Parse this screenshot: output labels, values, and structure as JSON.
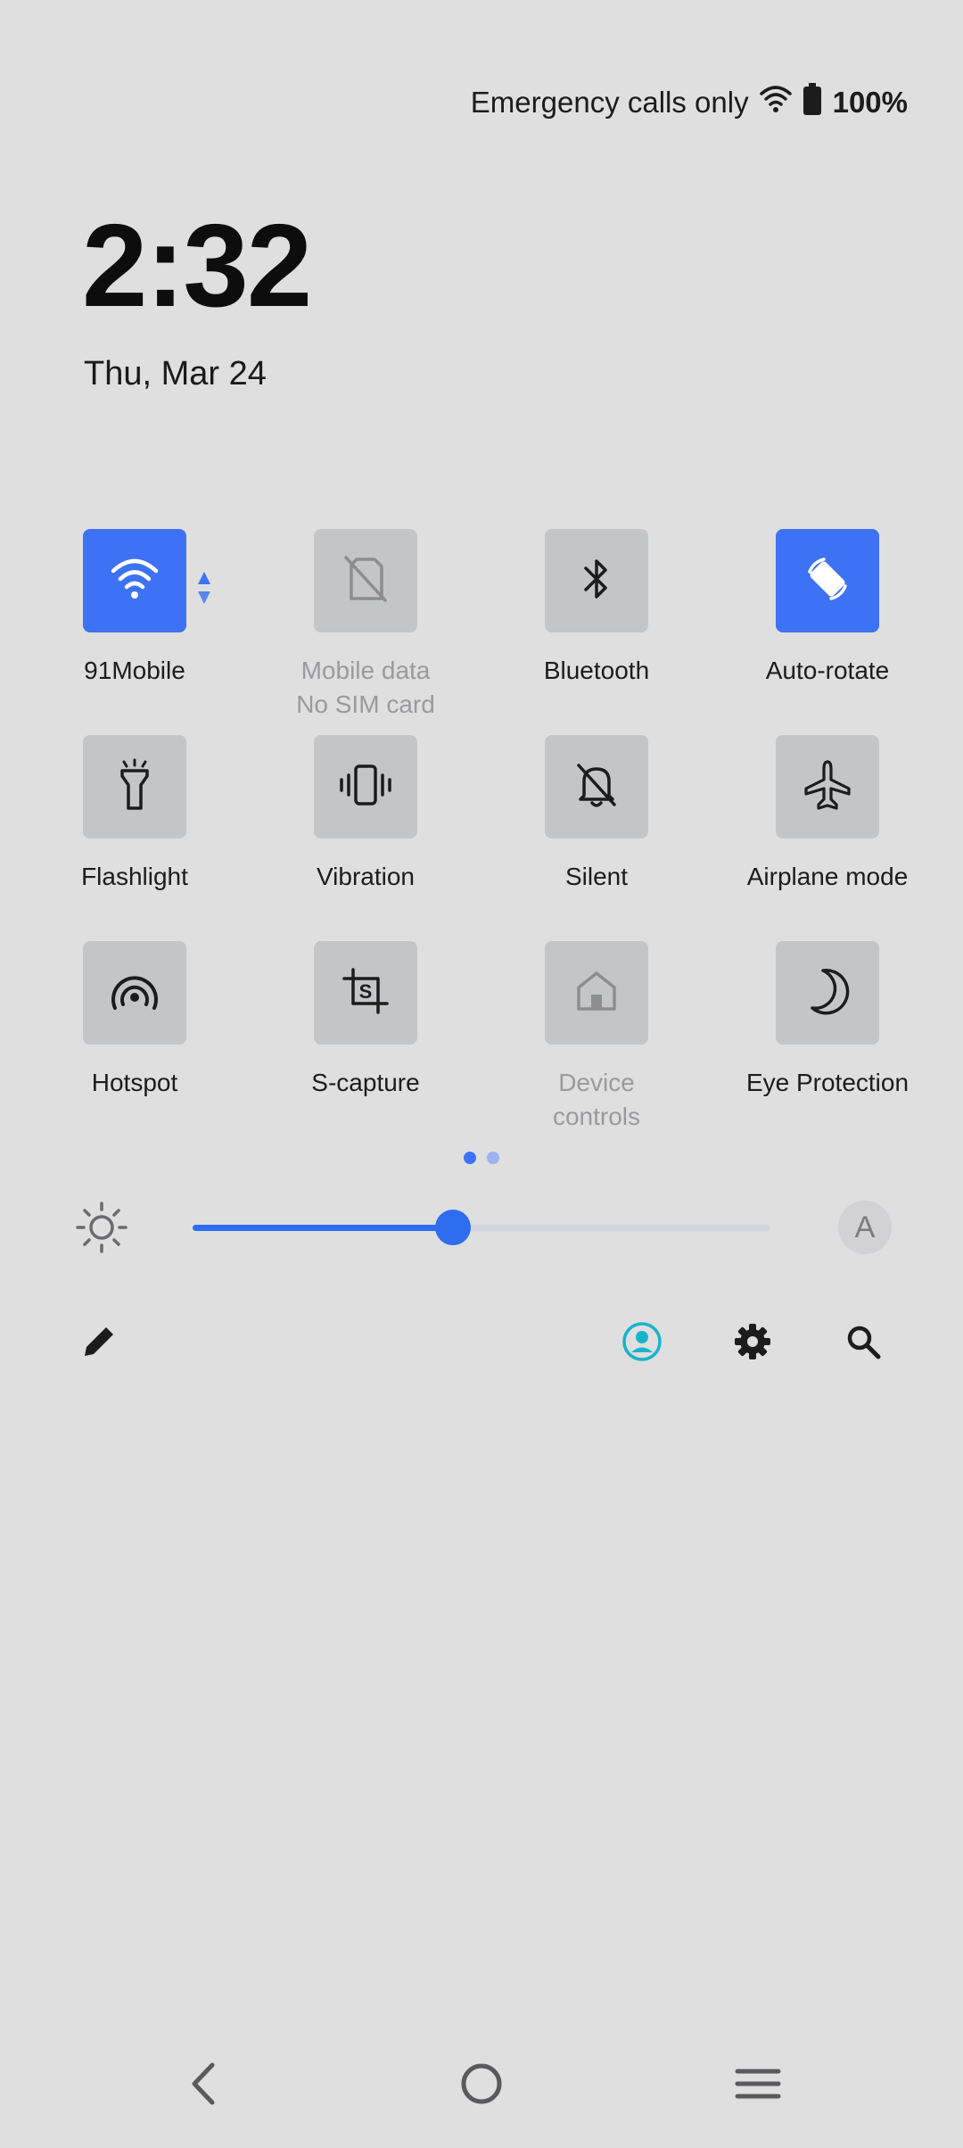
{
  "status_bar": {
    "carrier_text": "Emergency calls only",
    "battery": "100%",
    "icons": [
      "wifi-icon",
      "battery-icon"
    ]
  },
  "lockscreen": {
    "time": "2:32",
    "date": "Thu, Mar 24"
  },
  "tiles": [
    {
      "label": "91Mobile",
      "sublabel": "",
      "icon": "wifi-icon",
      "state": "on"
    },
    {
      "label": "Mobile data",
      "sublabel": "No SIM card",
      "icon": "sim-off-icon",
      "state": "disabled"
    },
    {
      "label": "Bluetooth",
      "sublabel": "",
      "icon": "bluetooth-icon",
      "state": "off"
    },
    {
      "label": "Auto-rotate",
      "sublabel": "",
      "icon": "auto-rotate-icon",
      "state": "on"
    },
    {
      "label": "Flashlight",
      "sublabel": "",
      "icon": "flashlight-icon",
      "state": "off"
    },
    {
      "label": "Vibration",
      "sublabel": "",
      "icon": "vibration-icon",
      "state": "off"
    },
    {
      "label": "Silent",
      "sublabel": "",
      "icon": "bell-off-icon",
      "state": "off"
    },
    {
      "label": "Airplane mode",
      "sublabel": "",
      "icon": "airplane-icon",
      "state": "off"
    },
    {
      "label": "Hotspot",
      "sublabel": "",
      "icon": "hotspot-icon",
      "state": "off"
    },
    {
      "label": "S-capture",
      "sublabel": "",
      "icon": "screenshot-icon",
      "state": "off"
    },
    {
      "label": "Device",
      "sublabel": "controls",
      "icon": "home-icon",
      "state": "disabled"
    },
    {
      "label": "Eye Protection",
      "sublabel": "",
      "icon": "moon-icon",
      "state": "off"
    }
  ],
  "pager": {
    "pages": 2,
    "current": 1
  },
  "brightness": {
    "level": 0.45,
    "auto_label": "A"
  },
  "toolbar": {
    "icons": [
      "edit-icon",
      "user-icon",
      "settings-icon",
      "search-icon"
    ]
  },
  "nav": {
    "icons": [
      "back-icon",
      "home-circle-icon",
      "menu-icon"
    ]
  },
  "colors": {
    "accent": "#3d72f5",
    "tile_off": "#c4c5c7",
    "background": "#dfdfe0",
    "user_icon": "#19b3cc"
  }
}
